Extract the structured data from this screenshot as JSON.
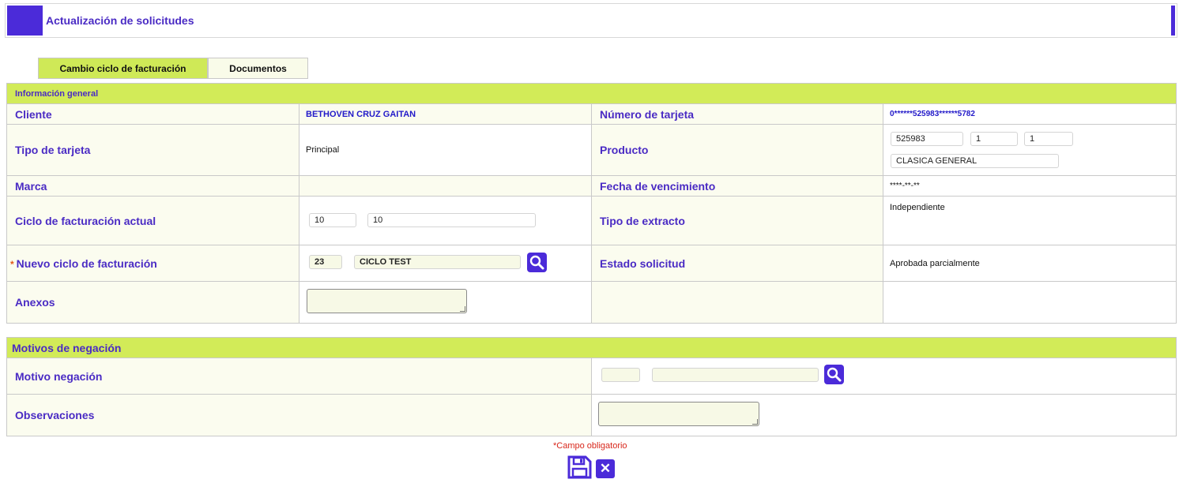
{
  "page": {
    "title": "Actualización de solicitudes"
  },
  "tabs": [
    {
      "label": "Cambio ciclo de facturación"
    },
    {
      "label": "Documentos"
    }
  ],
  "general": {
    "section_title": "Información general",
    "cliente_label": "Cliente",
    "cliente_value": "BETHOVEN CRUZ GAITAN",
    "numero_tarjeta_label": "Número de tarjeta",
    "numero_tarjeta_value": "0******525983******5782",
    "tipo_tarjeta_label": "Tipo de tarjeta",
    "tipo_tarjeta_value": "Principal",
    "producto_label": "Producto",
    "producto_code": "525983",
    "producto_f1": "1",
    "producto_f2": "1",
    "producto_name": "CLASICA GENERAL",
    "marca_label": "Marca",
    "marca_value": "",
    "fecha_venc_label": "Fecha de vencimiento",
    "fecha_venc_value": "****-**-**",
    "ciclo_actual_label": "Ciclo de facturación actual",
    "ciclo_actual_code": "10",
    "ciclo_actual_desc": "10",
    "tipo_extracto_label": "Tipo de extracto",
    "tipo_extracto_value": "Independiente",
    "nuevo_ciclo_label": "Nuevo ciclo de facturación",
    "nuevo_ciclo_code": "23",
    "nuevo_ciclo_desc": "CICLO TEST",
    "estado_label": "Estado solicitud",
    "estado_value": "Aprobada parcialmente",
    "anexos_label": "Anexos"
  },
  "negacion": {
    "section_title": "Motivos de negación",
    "motivo_label": "Motivo negación",
    "observaciones_label": "Observaciones"
  },
  "footer": {
    "required_note": "Campo obligatorio",
    "required_mark": "*"
  },
  "icons": {
    "search": "search-icon",
    "save": "save-icon",
    "close": "close-icon"
  },
  "colors": {
    "accent": "#4b2bd9",
    "section": "#d2eb58",
    "label_text": "#4a2bc4",
    "required": "#d8261a"
  }
}
